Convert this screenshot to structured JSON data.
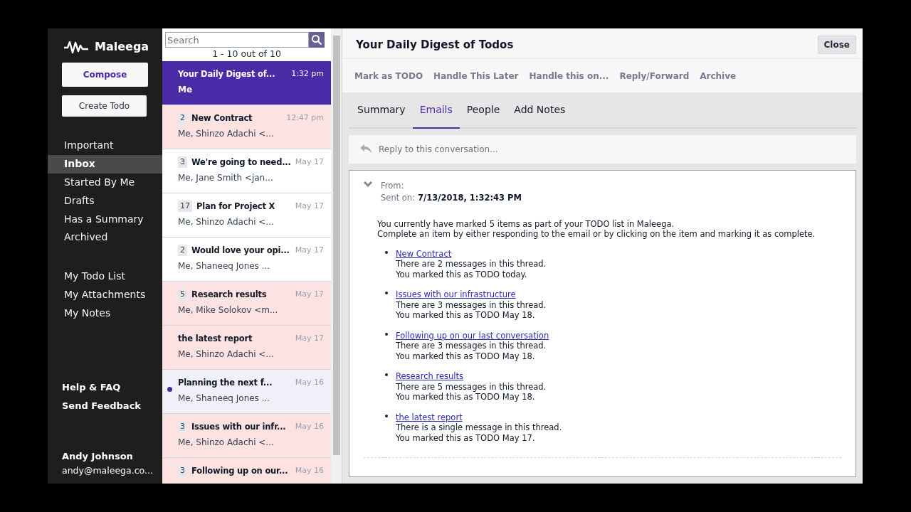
{
  "sidebar": {
    "logo": "Maleega",
    "compose": "Compose",
    "create_todo": "Create Todo",
    "nav": [
      {
        "label": "Important",
        "selected": false
      },
      {
        "label": "Inbox",
        "selected": true
      },
      {
        "label": "Started By Me",
        "selected": false
      },
      {
        "label": "Drafts",
        "selected": false
      },
      {
        "label": "Has a Summary",
        "selected": false
      },
      {
        "label": "Archived",
        "selected": false
      }
    ],
    "personal": [
      "My Todo List",
      "My Attachments",
      "My Notes"
    ],
    "links": [
      "Help & FAQ",
      "Send Feedback"
    ],
    "user": {
      "name": "Andy Johnson",
      "email": "andy@maleega.co..."
    }
  },
  "thread_list": {
    "search": {
      "placeholder": "Search"
    },
    "range": "1 - 10 out of 10",
    "threads": [
      {
        "subject": "Your Daily Digest of...",
        "from": "Me",
        "time": "1:32 pm",
        "selected": true
      },
      {
        "count": "2",
        "subject": "New Contract",
        "from": "Me, Shinzo Adachi <...",
        "time": "12:47 pm",
        "selected": false,
        "todo": true,
        "unread": false
      },
      {
        "count": "3",
        "subject": "We're going to need...",
        "from": "Me, Jane Smith <jan...",
        "time": "May 17",
        "selected": false,
        "todo": false,
        "unread": false
      },
      {
        "count": "17",
        "subject": "Plan for Project X",
        "from": "Me, Shinzo Adachi <...",
        "time": "May 17",
        "selected": false,
        "todo": false,
        "unread": false
      },
      {
        "count": "2",
        "subject": "Would love your opi...",
        "from": "Me, Shaneeq Jones ...",
        "time": "May 17",
        "selected": false,
        "todo": false,
        "unread": false
      },
      {
        "count": "5",
        "subject": "Research results",
        "from": "Me, Mike Solokov <m...",
        "time": "May 17",
        "selected": false,
        "todo": true,
        "unread": false
      },
      {
        "subject": "the latest report",
        "from": "Me, Shinzo Adachi <...",
        "time": "May 17",
        "selected": false,
        "todo": true,
        "unread": false
      },
      {
        "subject": "Planning the next f...",
        "from": "Me, Shaneeq Jones ...",
        "time": "May 16",
        "selected": false,
        "todo": false,
        "unread": true
      },
      {
        "count": "3",
        "subject": "Issues with our infr...",
        "from": "Me, Shinzo Adachi <...",
        "time": "May 16",
        "selected": false,
        "todo": true,
        "unread": false
      },
      {
        "count": "3",
        "subject": "Following up on our...",
        "time": "May 16",
        "selected": false,
        "todo": true,
        "unread": false
      }
    ]
  },
  "detail": {
    "title": "Your Daily Digest of Todos",
    "close": "Close",
    "actions": [
      "Mark as TODO",
      "Handle This Later",
      "Handle this on...",
      "Reply/Forward",
      "Archive"
    ],
    "tabs": [
      {
        "label": "Summary",
        "selected": false
      },
      {
        "label": "Emails",
        "selected": true
      },
      {
        "label": "People",
        "selected": false
      },
      {
        "label": "Add Notes",
        "selected": false
      }
    ],
    "reply": {
      "placeholder": "Reply to this conversation..."
    },
    "email": {
      "from_label": "From:",
      "sent_label": "Sent on:",
      "sent": "7/13/2018, 1:32:43 PM",
      "intro": [
        "You currently have marked 5 items as part of your TODO list in Maleega.",
        "Complete an item by either responding to the email or by clicking on the item and marking it as complete."
      ],
      "items": [
        {
          "link": "New Contract",
          "lines": [
            "There are 2 messages in this thread.",
            "You marked this as TODO today."
          ]
        },
        {
          "link": "Issues with our infrastructure",
          "lines": [
            "There are 3 messages in this thread.",
            "You marked this as TODO May 18."
          ]
        },
        {
          "link": "Following up on our last conversation",
          "lines": [
            "There are 3 messages in this thread.",
            "You marked this as TODO May 18."
          ]
        },
        {
          "link": "Research results",
          "lines": [
            "There are 5 messages in this thread.",
            "You marked this as TODO May 18."
          ]
        },
        {
          "link": "the latest report",
          "lines": [
            "There is a single message in this thread.",
            "You marked this as TODO May 17."
          ]
        }
      ]
    }
  }
}
